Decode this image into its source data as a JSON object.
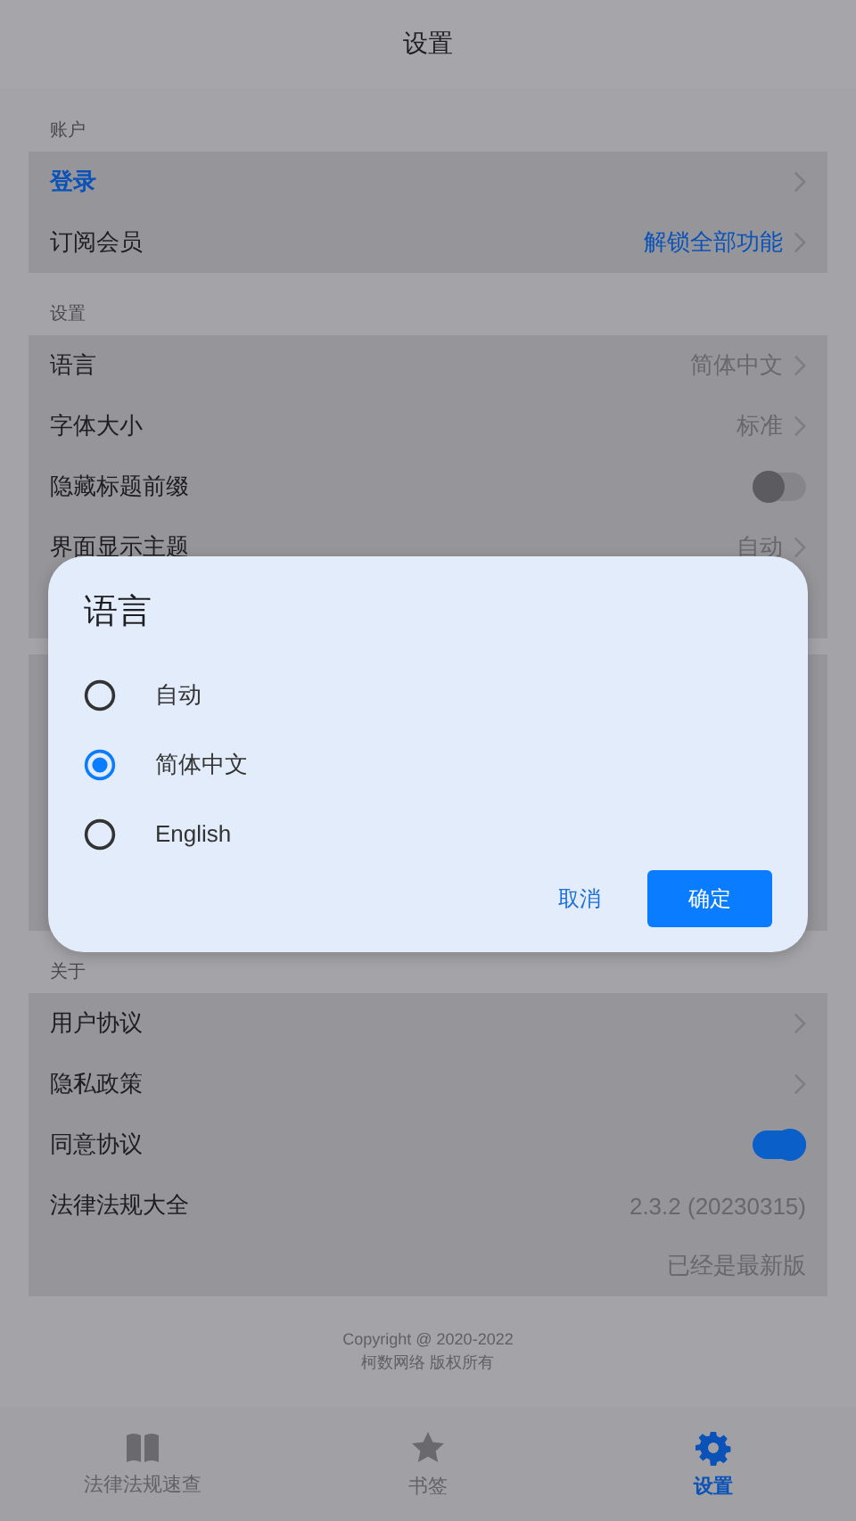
{
  "header": {
    "title": "设置"
  },
  "sections": [
    {
      "label": "账户",
      "rows": [
        {
          "kind": "nav",
          "label": "登录",
          "highlighted": true
        },
        {
          "kind": "nav",
          "label": "订阅会员",
          "value": "解锁全部功能",
          "highlighted": true
        }
      ]
    },
    {
      "label": "设置",
      "rows": [
        {
          "kind": "nav",
          "label": "语言",
          "value": "简体中文",
          "highlighted": false
        },
        {
          "kind": "nav",
          "label": "字体大小",
          "value": "标准",
          "highlighted": false
        },
        {
          "kind": "toggle",
          "label": "隐藏标题前缀",
          "on": false
        },
        {
          "kind": "nav",
          "label": "界面显示主题",
          "value": "自动",
          "highlighted": false
        }
      ]
    },
    {
      "label": "关于",
      "rows": [
        {
          "kind": "nav",
          "label": "用户协议",
          "highlighted": false
        },
        {
          "kind": "nav",
          "label": "隐私政策",
          "highlighted": false
        },
        {
          "kind": "toggle",
          "label": "同意协议",
          "on": true
        },
        {
          "kind": "info",
          "label": "法律法规大全",
          "value": "2.3.2 (20230315)"
        },
        {
          "kind": "note",
          "value": "已经是最新版"
        }
      ]
    }
  ],
  "footer": {
    "lines": [
      "Copyright @ 2020-2022",
      "柯数网络 版权所有"
    ]
  },
  "tabs": [
    {
      "kind": "book",
      "label": "法律法规速查",
      "selected": false
    },
    {
      "kind": "star",
      "label": "书签",
      "selected": false
    },
    {
      "kind": "gear",
      "label": "设置",
      "selected": true
    }
  ],
  "dialog": {
    "title": "语言",
    "options": [
      {
        "label": "自动",
        "selected": false
      },
      {
        "label": "简体中文",
        "selected": true
      },
      {
        "label": "English",
        "selected": false
      }
    ],
    "buttons": [
      {
        "kind": "text",
        "label": "取消"
      },
      {
        "kind": "filled",
        "label": "确定"
      }
    ]
  }
}
